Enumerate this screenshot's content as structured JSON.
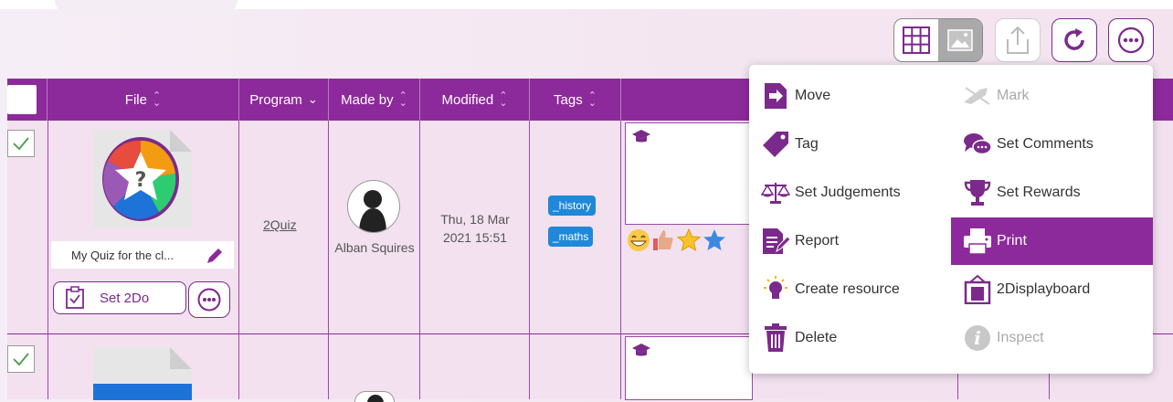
{
  "toolbar": {
    "grid_view_icon": "grid-icon",
    "image_view_icon": "image-icon",
    "upload_icon": "upload-icon",
    "refresh_icon": "refresh-icon",
    "more_icon": "more-icon"
  },
  "table": {
    "headers": {
      "file": "File",
      "program": "Program",
      "made_by": "Made by",
      "modified": "Modified",
      "tags": "Tags"
    },
    "rows": [
      {
        "file_name": "My Quiz for the cl...",
        "program": "2Quiz",
        "made_by": "Alban Squires",
        "modified_line1": "Thu, 18 Mar",
        "modified_line2": "2021 15:51",
        "tags": [
          "_history",
          "_maths"
        ],
        "set2do_label": "Set 2Do"
      }
    ]
  },
  "menu": {
    "items": [
      {
        "label": "Move",
        "icon": "move-icon",
        "enabled": true
      },
      {
        "label": "Mark",
        "icon": "mark-icon",
        "enabled": false
      },
      {
        "label": "Tag",
        "icon": "tag-icon",
        "enabled": true
      },
      {
        "label": "Set Comments",
        "icon": "comments-icon",
        "enabled": true
      },
      {
        "label": "Set Judgements",
        "icon": "scales-icon",
        "enabled": true
      },
      {
        "label": "Set Rewards",
        "icon": "trophy-icon",
        "enabled": true
      },
      {
        "label": "Report",
        "icon": "report-icon",
        "enabled": true
      },
      {
        "label": "Print",
        "icon": "print-icon",
        "enabled": true,
        "active": true
      },
      {
        "label": "Create resource",
        "icon": "lightbulb-icon",
        "enabled": true
      },
      {
        "label": "2Displayboard",
        "icon": "displayboard-icon",
        "enabled": true
      },
      {
        "label": "Delete",
        "icon": "trash-icon",
        "enabled": true
      },
      {
        "label": "Inspect",
        "icon": "info-icon",
        "enabled": false
      }
    ]
  },
  "colors": {
    "accent": "#8d2a9b",
    "row_bg": "#f3e1f0",
    "tag_bg": "#1f88d8"
  }
}
